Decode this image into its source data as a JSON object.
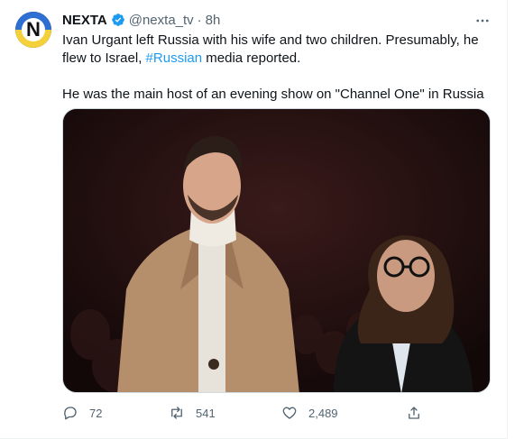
{
  "tweet": {
    "author_name": "NEXTA",
    "author_handle": "@nexta_tv",
    "separator": "·",
    "time": "8h",
    "text_p1_before": "Ivan Urgant left Russia with his wife and two children. Presumably, he flew to Israel, ",
    "hashtag": "#Russian",
    "text_p1_after": " media reported.",
    "text_p2": "He was the main host of an evening show on \"Channel One\" in Russia",
    "avatar_letter": "N"
  },
  "actions": {
    "reply_count": "72",
    "retweet_count": "541",
    "like_count": "2,489"
  },
  "icons": {
    "verified": "verified-badge-icon",
    "more": "more-options-icon",
    "reply": "reply-icon",
    "retweet": "retweet-icon",
    "like": "heart-icon",
    "share": "share-icon"
  },
  "colors": {
    "accent": "#1d9bf0",
    "muted": "#536471",
    "text": "#0f1419"
  }
}
